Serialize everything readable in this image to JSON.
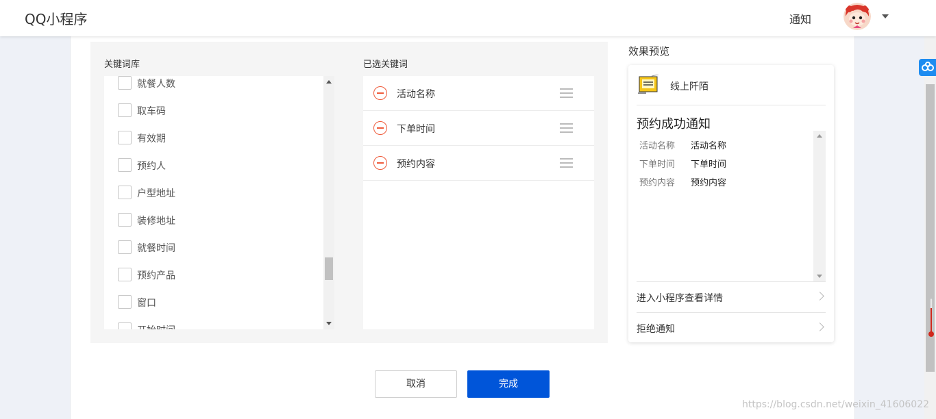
{
  "header": {
    "brand": "QQ小程序",
    "notice_label": "通知"
  },
  "keyword_library": {
    "title": "关键词库",
    "items": [
      {
        "label": "就餐人数"
      },
      {
        "label": "取车码"
      },
      {
        "label": "有效期"
      },
      {
        "label": "预约人"
      },
      {
        "label": "户型地址"
      },
      {
        "label": "装修地址"
      },
      {
        "label": "就餐时间"
      },
      {
        "label": "预约产品"
      },
      {
        "label": "窗口"
      },
      {
        "label": "开始时间"
      }
    ]
  },
  "selected_keywords": {
    "title": "已选关键词",
    "items": [
      {
        "label": "活动名称"
      },
      {
        "label": "下单时间"
      },
      {
        "label": "预约内容"
      }
    ]
  },
  "preview": {
    "title": "效果预览",
    "app_name": "线上阡陌",
    "message_title": "预约成功通知",
    "rows": [
      {
        "key": "活动名称",
        "value": "活动名称"
      },
      {
        "key": "下单时间",
        "value": "下单时间"
      },
      {
        "key": "预约内容",
        "value": "预约内容"
      }
    ],
    "link_details": "进入小程序查看详情",
    "link_reject": "拒绝通知"
  },
  "actions": {
    "cancel_label": "取消",
    "done_label": "完成"
  },
  "watermark": "https://blog.csdn.net/weixin_41606022",
  "colors": {
    "primary": "#0055d9",
    "remove": "#ef5b3b",
    "panel_bg": "#f5f5f5",
    "page_bg": "#eef1f7"
  },
  "icons": {
    "avatar": "cartoon-avatar-icon",
    "remove": "minus-circle-icon",
    "drag": "drag-handle-icon",
    "app": "app-logo-icon",
    "link": "chevron-right-icon"
  }
}
